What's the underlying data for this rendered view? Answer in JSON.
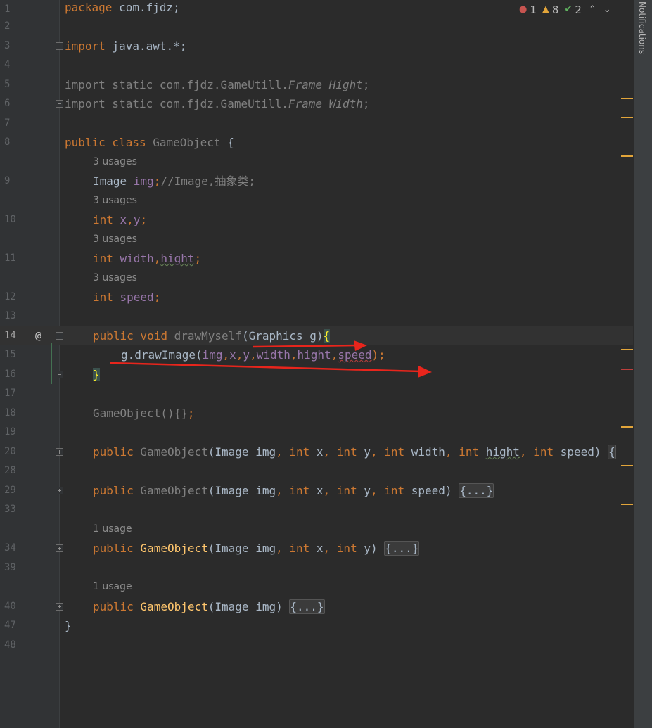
{
  "editor": {
    "notifications_label": "Notifications",
    "inspections": {
      "errors": "1",
      "warnings": "8",
      "typos": "2",
      "up_arrow": "⌃",
      "down_arrow": "⌄"
    },
    "line_numbers": [
      "1",
      "2",
      "3",
      "4",
      "5",
      "6",
      "7",
      "8",
      "9",
      "10",
      "11",
      "12",
      "13",
      "14",
      "15",
      "16",
      "17",
      "18",
      "19",
      "20",
      "28",
      "29",
      "33",
      "34",
      "39",
      "40",
      "47",
      "48"
    ],
    "usages": {
      "three": "3 usages",
      "one": "1 usage"
    },
    "code": {
      "l1_kw": "package",
      "l1_rest": " com.fjdz;",
      "l3_kw": "import",
      "l3_rest": " java.awt.*;",
      "l5_text": "import static com.fjdz.GameUtill.",
      "l5_field": "Frame_Hight",
      "l5_end": ";",
      "l6_text": "import static com.fjdz.GameUtill.",
      "l6_field": "Frame_Width",
      "l6_end": ";",
      "l8_kw": "public class",
      "l8_name": " GameObject",
      "l8_end": " {",
      "l9_type": "Image ",
      "l9_field": "img",
      "l9_semi": ";",
      "l9_comment": "//Image,抽象类;",
      "l10_kw": "int ",
      "l10_x": "x",
      "l10_comma": ",",
      "l10_y": "y",
      "l10_semi": ";",
      "l11_kw": "int ",
      "l11_width": "width",
      "l11_comma": ",",
      "l11_hight": "hight",
      "l11_semi": ";",
      "l12_kw": "int ",
      "l12_speed": "speed",
      "l12_semi": ";",
      "l14_kw": "public void",
      "l14_name": " drawMyself",
      "l14_params": "(Graphics g)",
      "l14_brace": "{",
      "l15_call": "g.drawImage(",
      "l15_img": "img",
      "l15_x": "x",
      "l15_y": "y",
      "l15_width": "width",
      "l15_hight": "hight",
      "l15_speed": "speed",
      "l15_comma": ",",
      "l15_end": ");",
      "l16_brace": "}",
      "l18_text": "GameObject(){}",
      "l18_semi": ";",
      "l20_kw": "public",
      "l20_name": " GameObject",
      "l20_p1": "(Image img",
      "l20_int": "int",
      "l20_x": " x",
      "l20_y": " y",
      "l20_w": " width",
      "l20_h": "hight",
      "l20_s": " speed)",
      "l20_comma": ", ",
      "l20_fold": "{",
      "l29_kw": "public",
      "l29_name": " GameObject",
      "l29_p1": "(Image img",
      "l29_int": "int",
      "l29_x": " x",
      "l29_y": " y",
      "l29_s": " speed)",
      "l29_comma": ", ",
      "l29_fold": "{...}",
      "l34_kw": "public",
      "l34_name": " GameObject",
      "l34_p1": "(Image img",
      "l34_int": "int",
      "l34_x": " x",
      "l34_y": " y)",
      "l34_comma": ", ",
      "l34_fold": "{...}",
      "l40_kw": "public",
      "l40_name": " GameObject",
      "l40_p1": "(Image img) ",
      "l40_fold": "{...}",
      "l47_brace": "}"
    }
  }
}
